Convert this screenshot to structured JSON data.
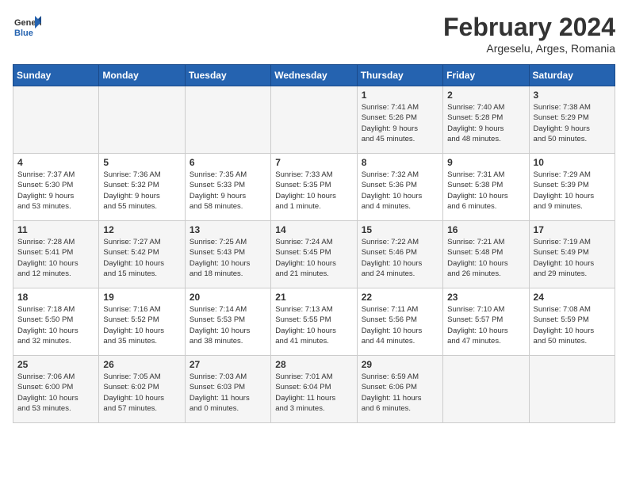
{
  "header": {
    "logo_line1": "General",
    "logo_line2": "Blue",
    "month": "February 2024",
    "location": "Argeselu, Arges, Romania"
  },
  "days_of_week": [
    "Sunday",
    "Monday",
    "Tuesday",
    "Wednesday",
    "Thursday",
    "Friday",
    "Saturday"
  ],
  "weeks": [
    [
      {
        "day": "",
        "info": ""
      },
      {
        "day": "",
        "info": ""
      },
      {
        "day": "",
        "info": ""
      },
      {
        "day": "",
        "info": ""
      },
      {
        "day": "1",
        "info": "Sunrise: 7:41 AM\nSunset: 5:26 PM\nDaylight: 9 hours\nand 45 minutes."
      },
      {
        "day": "2",
        "info": "Sunrise: 7:40 AM\nSunset: 5:28 PM\nDaylight: 9 hours\nand 48 minutes."
      },
      {
        "day": "3",
        "info": "Sunrise: 7:38 AM\nSunset: 5:29 PM\nDaylight: 9 hours\nand 50 minutes."
      }
    ],
    [
      {
        "day": "4",
        "info": "Sunrise: 7:37 AM\nSunset: 5:30 PM\nDaylight: 9 hours\nand 53 minutes."
      },
      {
        "day": "5",
        "info": "Sunrise: 7:36 AM\nSunset: 5:32 PM\nDaylight: 9 hours\nand 55 minutes."
      },
      {
        "day": "6",
        "info": "Sunrise: 7:35 AM\nSunset: 5:33 PM\nDaylight: 9 hours\nand 58 minutes."
      },
      {
        "day": "7",
        "info": "Sunrise: 7:33 AM\nSunset: 5:35 PM\nDaylight: 10 hours\nand 1 minute."
      },
      {
        "day": "8",
        "info": "Sunrise: 7:32 AM\nSunset: 5:36 PM\nDaylight: 10 hours\nand 4 minutes."
      },
      {
        "day": "9",
        "info": "Sunrise: 7:31 AM\nSunset: 5:38 PM\nDaylight: 10 hours\nand 6 minutes."
      },
      {
        "day": "10",
        "info": "Sunrise: 7:29 AM\nSunset: 5:39 PM\nDaylight: 10 hours\nand 9 minutes."
      }
    ],
    [
      {
        "day": "11",
        "info": "Sunrise: 7:28 AM\nSunset: 5:41 PM\nDaylight: 10 hours\nand 12 minutes."
      },
      {
        "day": "12",
        "info": "Sunrise: 7:27 AM\nSunset: 5:42 PM\nDaylight: 10 hours\nand 15 minutes."
      },
      {
        "day": "13",
        "info": "Sunrise: 7:25 AM\nSunset: 5:43 PM\nDaylight: 10 hours\nand 18 minutes."
      },
      {
        "day": "14",
        "info": "Sunrise: 7:24 AM\nSunset: 5:45 PM\nDaylight: 10 hours\nand 21 minutes."
      },
      {
        "day": "15",
        "info": "Sunrise: 7:22 AM\nSunset: 5:46 PM\nDaylight: 10 hours\nand 24 minutes."
      },
      {
        "day": "16",
        "info": "Sunrise: 7:21 AM\nSunset: 5:48 PM\nDaylight: 10 hours\nand 26 minutes."
      },
      {
        "day": "17",
        "info": "Sunrise: 7:19 AM\nSunset: 5:49 PM\nDaylight: 10 hours\nand 29 minutes."
      }
    ],
    [
      {
        "day": "18",
        "info": "Sunrise: 7:18 AM\nSunset: 5:50 PM\nDaylight: 10 hours\nand 32 minutes."
      },
      {
        "day": "19",
        "info": "Sunrise: 7:16 AM\nSunset: 5:52 PM\nDaylight: 10 hours\nand 35 minutes."
      },
      {
        "day": "20",
        "info": "Sunrise: 7:14 AM\nSunset: 5:53 PM\nDaylight: 10 hours\nand 38 minutes."
      },
      {
        "day": "21",
        "info": "Sunrise: 7:13 AM\nSunset: 5:55 PM\nDaylight: 10 hours\nand 41 minutes."
      },
      {
        "day": "22",
        "info": "Sunrise: 7:11 AM\nSunset: 5:56 PM\nDaylight: 10 hours\nand 44 minutes."
      },
      {
        "day": "23",
        "info": "Sunrise: 7:10 AM\nSunset: 5:57 PM\nDaylight: 10 hours\nand 47 minutes."
      },
      {
        "day": "24",
        "info": "Sunrise: 7:08 AM\nSunset: 5:59 PM\nDaylight: 10 hours\nand 50 minutes."
      }
    ],
    [
      {
        "day": "25",
        "info": "Sunrise: 7:06 AM\nSunset: 6:00 PM\nDaylight: 10 hours\nand 53 minutes."
      },
      {
        "day": "26",
        "info": "Sunrise: 7:05 AM\nSunset: 6:02 PM\nDaylight: 10 hours\nand 57 minutes."
      },
      {
        "day": "27",
        "info": "Sunrise: 7:03 AM\nSunset: 6:03 PM\nDaylight: 11 hours\nand 0 minutes."
      },
      {
        "day": "28",
        "info": "Sunrise: 7:01 AM\nSunset: 6:04 PM\nDaylight: 11 hours\nand 3 minutes."
      },
      {
        "day": "29",
        "info": "Sunrise: 6:59 AM\nSunset: 6:06 PM\nDaylight: 11 hours\nand 6 minutes."
      },
      {
        "day": "",
        "info": ""
      },
      {
        "day": "",
        "info": ""
      }
    ]
  ]
}
